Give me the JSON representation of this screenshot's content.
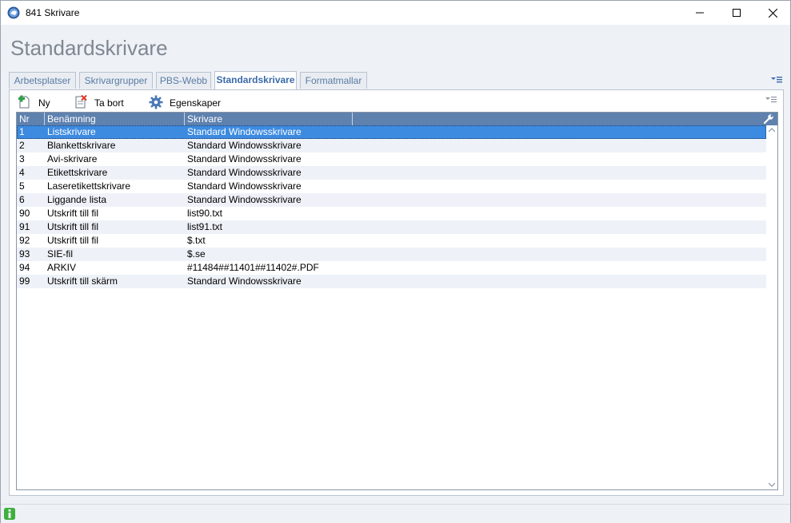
{
  "window": {
    "title": "841 Skrivare",
    "accent": "#5f81ae",
    "selection_color": "#3d8be0"
  },
  "page": {
    "title": "Standardskrivare"
  },
  "tabs": [
    {
      "label": "Arbetsplatser",
      "active": false
    },
    {
      "label": "Skrivargrupper",
      "active": false
    },
    {
      "label": "PBS-Webb",
      "active": false
    },
    {
      "label": "Standardskrivare",
      "active": true
    },
    {
      "label": "Formatmallar",
      "active": false
    }
  ],
  "toolbar": {
    "new_label": "Ny",
    "delete_label": "Ta bort",
    "properties_label": "Egenskaper"
  },
  "grid": {
    "columns": [
      "Nr",
      "Benämning",
      "Skrivare"
    ],
    "rows": [
      {
        "nr": "1",
        "benamning": "Listskrivare",
        "skrivare": "Standard Windowsskrivare",
        "selected": true
      },
      {
        "nr": "2",
        "benamning": "Blankettskrivare",
        "skrivare": "Standard Windowsskrivare"
      },
      {
        "nr": "3",
        "benamning": "Avi-skrivare",
        "skrivare": "Standard Windowsskrivare"
      },
      {
        "nr": "4",
        "benamning": "Etikettskrivare",
        "skrivare": "Standard Windowsskrivare"
      },
      {
        "nr": "5",
        "benamning": "Laseretikettskrivare",
        "skrivare": "Standard Windowsskrivare"
      },
      {
        "nr": "6",
        "benamning": "Liggande lista",
        "skrivare": "Standard Windowsskrivare"
      },
      {
        "nr": "90",
        "benamning": "Utskrift till fil",
        "skrivare": "list90.txt"
      },
      {
        "nr": "91",
        "benamning": "Utskrift till fil",
        "skrivare": "list91.txt"
      },
      {
        "nr": "92",
        "benamning": "Utskrift till fil",
        "skrivare": "$.txt"
      },
      {
        "nr": "93",
        "benamning": "SIE-fil",
        "skrivare": "$.se"
      },
      {
        "nr": "94",
        "benamning": "ARKIV",
        "skrivare": "#11484##11401##11402#.PDF"
      },
      {
        "nr": "99",
        "benamning": "Utskrift till skärm",
        "skrivare": "Standard Windowsskrivare"
      }
    ]
  },
  "icons": {
    "app": "app-globe-icon",
    "new": "add-document-icon",
    "delete": "delete-document-icon",
    "properties": "gear-icon",
    "grid_settings": "wrench-icon",
    "status": "info-icon"
  }
}
